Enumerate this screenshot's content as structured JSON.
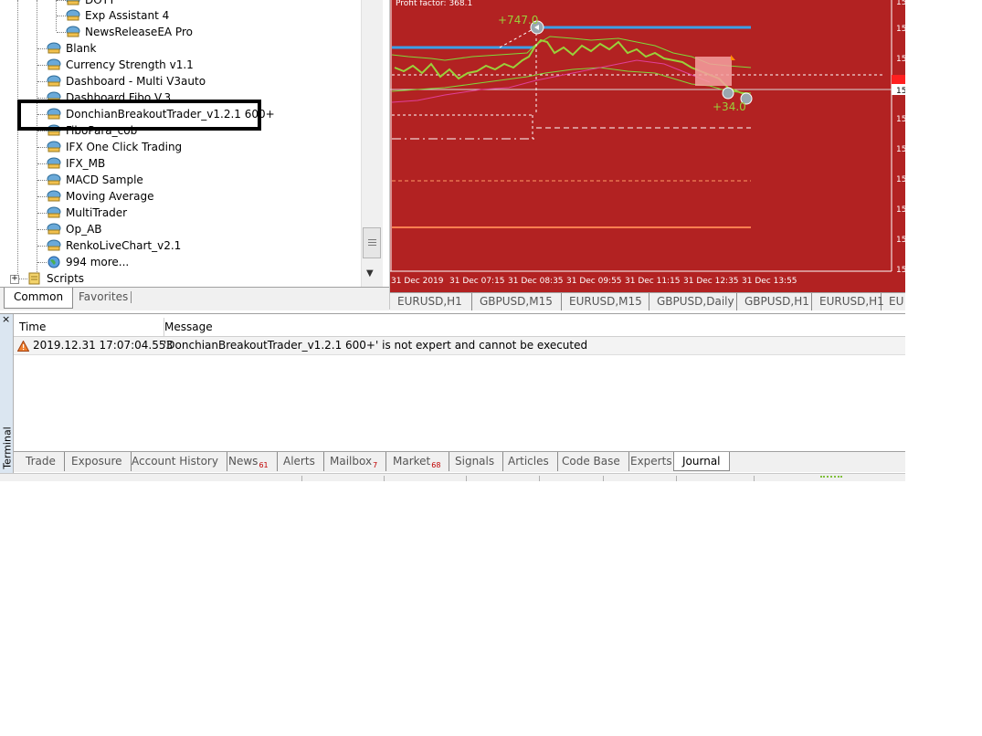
{
  "navigator": {
    "items": [
      {
        "label": "DOTT",
        "indent": 2
      },
      {
        "label": "Exp Assistant 4",
        "indent": 2
      },
      {
        "label": "NewsReleaseEA Pro",
        "indent": 2
      },
      {
        "label": "Blank",
        "indent": 1
      },
      {
        "label": "Currency Strength v1.1",
        "indent": 1
      },
      {
        "label": "Dashboard - Multi V3auto",
        "indent": 1
      },
      {
        "label": "Dashboard Fibo V.3",
        "indent": 1
      },
      {
        "label": "DonchianBreakoutTrader_v1.2.1 600+",
        "indent": 1
      },
      {
        "label": "FiboPara_cob",
        "indent": 1
      },
      {
        "label": "IFX One Click Trading",
        "indent": 1
      },
      {
        "label": "IFX_MB",
        "indent": 1
      },
      {
        "label": "MACD Sample",
        "indent": 1
      },
      {
        "label": "Moving Average",
        "indent": 1
      },
      {
        "label": "MultiTrader",
        "indent": 1
      },
      {
        "label": "Op_AB",
        "indent": 1
      },
      {
        "label": "RenkoLiveChart_v2.1",
        "indent": 1
      },
      {
        "label": "994 more...",
        "indent": 1,
        "icon": "globe"
      },
      {
        "label": "Scripts",
        "indent": 0,
        "icon": "scripts"
      }
    ],
    "tabs": {
      "common": "Common",
      "favorites": "Favorites"
    }
  },
  "chart": {
    "profit_label": "Profit factor: 368.1",
    "trade_labels": [
      "+747.0",
      "+34.0"
    ],
    "price_tick": "15",
    "time_labels": [
      "31 Dec 2019",
      "31 Dec 07:15",
      "31 Dec 08:35",
      "31 Dec 09:55",
      "31 Dec 11:15",
      "31 Dec 12:35",
      "31 Dec 13:55"
    ],
    "background": "#b22222"
  },
  "chart_tabs": [
    "EURUSD,H1",
    "GBPUSD,M15",
    "EURUSD,M15",
    "GBPUSD,Daily",
    "GBPUSD,H1",
    "EURUSD,H1",
    "EU"
  ],
  "terminal": {
    "label": "Terminal",
    "close": "×",
    "columns": {
      "time": "Time",
      "message": "Message"
    },
    "rows": [
      {
        "time": "2019.12.31 17:07:04.553",
        "message": "'DonchianBreakoutTrader_v1.2.1 600+' is not expert and cannot be executed"
      }
    ],
    "tabs": [
      {
        "label": "Trade"
      },
      {
        "label": "Exposure"
      },
      {
        "label": "Account History"
      },
      {
        "label": "News",
        "badge": "61"
      },
      {
        "label": "Alerts"
      },
      {
        "label": "Mailbox",
        "badge": "7"
      },
      {
        "label": "Market",
        "badge": "68"
      },
      {
        "label": "Signals"
      },
      {
        "label": "Articles"
      },
      {
        "label": "Code Base"
      },
      {
        "label": "Experts"
      },
      {
        "label": "Journal",
        "active": true
      }
    ]
  }
}
